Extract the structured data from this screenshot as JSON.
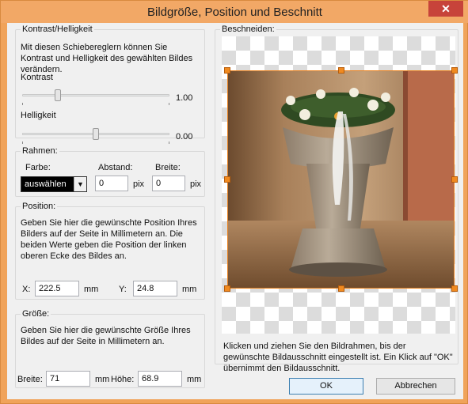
{
  "window": {
    "title": "Bildgröße, Position und Beschnitt",
    "close_glyph": "✕"
  },
  "contrast": {
    "legend": "Kontrast/Helligkeit",
    "description": "Mit diesen Schiebereglern können Sie Kontrast und Helligkeit des gewählten Bildes verändern.",
    "contrast_label": "Kontrast",
    "contrast_value": "1.00",
    "contrast_level": 0.23,
    "brightness_label": "Helligkeit",
    "brightness_value": "0.00",
    "brightness_level": 0.5
  },
  "frame": {
    "legend": "Rahmen:",
    "color_label": "Farbe:",
    "color_value": "auswählen",
    "distance_label": "Abstand:",
    "distance_value": "0",
    "distance_unit": "pix",
    "width_label": "Breite:",
    "width_value": "0",
    "width_unit": "pix"
  },
  "position": {
    "legend": "Position:",
    "description": "Geben Sie hier die gewünschte Position Ihres Bilders auf der Seite in Millimetern an. Die beiden Werte geben die Position der linken oberen Ecke des Bildes an.",
    "x_label": "X:",
    "x_value": "222.5",
    "x_unit": "mm",
    "y_label": "Y:",
    "y_value": "24.8",
    "y_unit": "mm"
  },
  "size": {
    "legend": "Größe:",
    "description": "Geben Sie hier die gewünschte Größe Ihres Bildes auf der Seite in Millimetern an.",
    "width_label": "Breite:",
    "width_value": "71",
    "width_unit": "mm",
    "height_label": "Höhe:",
    "height_value": "68.9",
    "height_unit": "mm"
  },
  "crop": {
    "legend": "Beschneiden:",
    "hint": "Klicken und ziehen Sie den Bildrahmen, bis der gewünschte Bildausschnitt eingestellt ist. Ein Klick auf \"OK\" übernimmt den Bildausschnitt.",
    "frame_color": "#e8801c"
  },
  "buttons": {
    "ok": "OK",
    "cancel": "Abbrechen"
  },
  "colors": {
    "titlebar": "#f2a866",
    "close": "#c7433a",
    "dialog": "#f0f0f0",
    "selection": "#000000"
  }
}
